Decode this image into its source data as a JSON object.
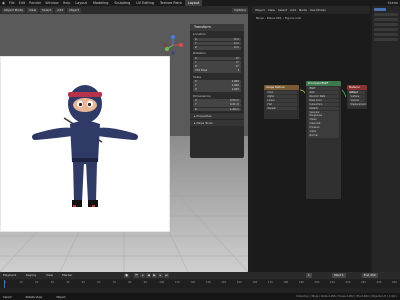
{
  "topbar": {
    "menus": [
      "File",
      "Edit",
      "Render",
      "Window",
      "Help"
    ],
    "tabs": [
      "Layout",
      "Modeling",
      "Sculpting",
      "UV Editing",
      "Texture Paint",
      "Layout"
    ],
    "active_tab_index": 5,
    "scene": "Scene"
  },
  "viewport": {
    "header": {
      "mode": "Object Mode",
      "view": "View",
      "select": "Select",
      "add": "Add",
      "object": "Object",
      "options": "Options"
    },
    "gizmo": {
      "x": "X",
      "y": "Y",
      "z": "Z"
    }
  },
  "npanel": {
    "title": "Transform",
    "location": {
      "label": "Location",
      "x": "0 m",
      "y": "0 m",
      "z": "0 m"
    },
    "rotation": {
      "label": "Rotation",
      "x": "0°",
      "y": "0°",
      "z": "0°",
      "mode": "XYZ Euler"
    },
    "scale": {
      "label": "Scale",
      "x": "1.000",
      "y": "1.000",
      "z": "1.000"
    },
    "dimensions": {
      "label": "Dimensions",
      "x": "0.55 m",
      "y": "0.21 m",
      "z": "1.49 m"
    },
    "properties": "Properties",
    "view": "Ninja Tools"
  },
  "node_editor": {
    "header": [
      "Object",
      "View",
      "Select",
      "Add",
      "Node",
      "Use Nodes"
    ],
    "breadcrumb": [
      "Ninja",
      "Plane.001",
      "Figure.mat"
    ],
    "nodes": [
      {
        "title": "Image Texture",
        "color": "#7a5a32",
        "rows": [
          "Color",
          "Alpha",
          "Linear",
          "Flat",
          "Repeat"
        ]
      },
      {
        "title": "Principled BSDF",
        "color": "#3c7a4e",
        "rows": [
          "BSDF",
          "GGX",
          "Random Walk",
          "Base Color",
          "Subsurface",
          "Metallic",
          "Specular",
          "Roughness",
          "Sheen",
          "Clearcoat",
          "Emission",
          "Alpha",
          "Normal"
        ]
      },
      {
        "title": "Material Output",
        "color": "#8a3232",
        "rows": [
          "All",
          "Surface",
          "Volume",
          "Displacement"
        ]
      }
    ]
  },
  "timeline": {
    "playback": "Playback",
    "keying": "Keying",
    "view": "View",
    "marker": "Marker",
    "current_frame": "1",
    "start": "Start 1",
    "end": "End 250",
    "ticks": [
      "0",
      "10",
      "20",
      "30",
      "40",
      "50",
      "60",
      "70",
      "80",
      "90",
      "100",
      "110",
      "120",
      "130",
      "140",
      "150",
      "160",
      "170",
      "180",
      "190",
      "200",
      "210",
      "220",
      "230",
      "240",
      "250"
    ]
  },
  "status": {
    "left": "Select",
    "middle": "Rotate View",
    "right": "Object",
    "version": "Collection | Ninja | Verts:4,956 | Faces:4,902 | Tris:9,600 | Objects:1/3 | 2.90.1"
  },
  "colors": {
    "accent": "#4772b3",
    "ninja_suit": "#2f3a67",
    "headband": "#b8324a",
    "skin": "#e8b598"
  }
}
